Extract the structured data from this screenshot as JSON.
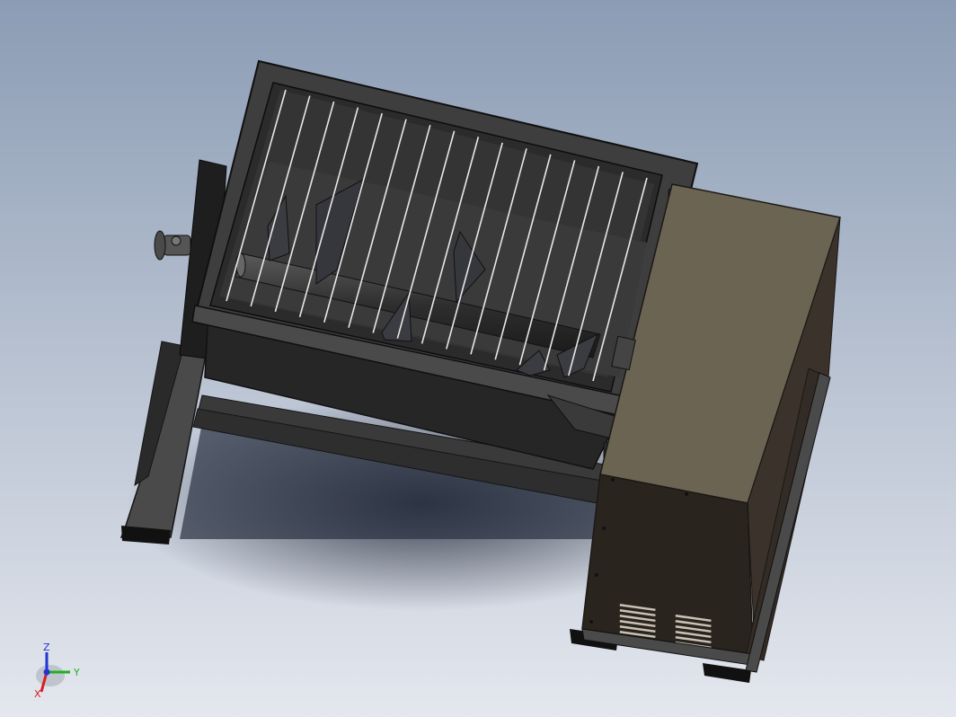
{
  "viewport": {
    "background_top": "#8b9cb4",
    "background_bottom": "#e4e7ee"
  },
  "model": {
    "frame_color": "#3c3c3c",
    "frame_edge_color": "#151515",
    "hopper_color": "#2d2d2d",
    "grille_color": "#e8e8e8",
    "paddle_color": "#3a3a40",
    "cabinet_top_color": "#6b6453",
    "cabinet_front_color": "#2a241f",
    "cabinet_side_color": "#3a322b",
    "vent_color": "#c9c2b5"
  },
  "triad": {
    "x_label": "X",
    "y_label": "Y",
    "z_label": "Z",
    "x_color": "#d81e1e",
    "y_color": "#1fb020",
    "z_color": "#2233d8"
  }
}
